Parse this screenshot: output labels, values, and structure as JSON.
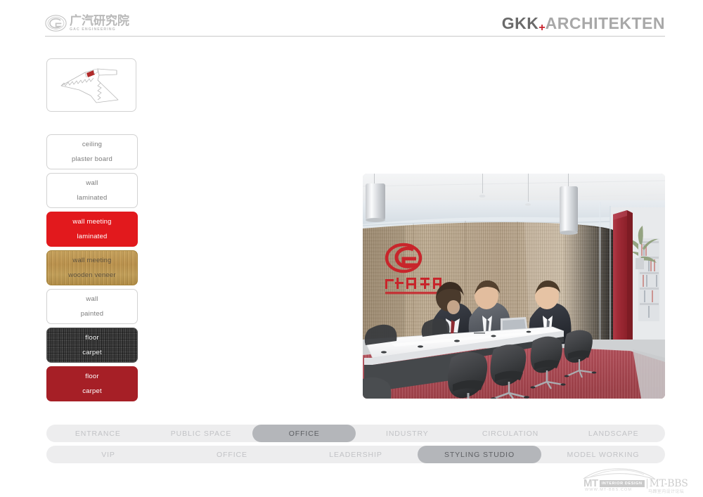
{
  "header": {
    "gac_logo": {
      "icon": "gac-g-emblem-icon",
      "chinese_name": "广汽研究院",
      "english_name": "GAC ENGINEERING"
    },
    "gkk_logo": {
      "part1": "GKK",
      "plus": "+",
      "part2": "ARCHITEKTEN",
      "accent_color": "#c8202a"
    }
  },
  "sidebar": {
    "plan_thumbnail": {
      "icon": "floor-plan-thumbnail-icon",
      "highlight_color": "#b02a2a"
    },
    "swatches": [
      {
        "element": "ceiling",
        "material": "plaster board",
        "style": "plain",
        "color": "#ffffff"
      },
      {
        "element": "wall",
        "material": "laminated",
        "style": "plain",
        "color": "#ffffff"
      },
      {
        "element": "wall meeting",
        "material": "laminated",
        "style": "red",
        "color": "#e2191d"
      },
      {
        "element": "wall meeting",
        "material": "wooden veneer",
        "style": "wood",
        "color": "#bb9149"
      },
      {
        "element": "wall",
        "material": "painted",
        "style": "plain",
        "color": "#ffffff"
      },
      {
        "element": "floor",
        "material": "carpet",
        "style": "carpet",
        "color": "#3a3a3a"
      },
      {
        "element": "floor",
        "material": "carpet",
        "style": "darkred",
        "color": "#a61f26"
      }
    ]
  },
  "main": {
    "render": {
      "name": "meeting-room-render",
      "description": "Office meeting room interior render with wood veneer wall, red GAC logo, white conference table, black chairs, red carpet and red column",
      "wall_logo_text": "广汽研究院",
      "wall_logo_color": "#c8252b",
      "carpet_color": "#b05058",
      "column_color": "#a8303c",
      "wood_wall_color": "#b49f82"
    }
  },
  "nav": {
    "primary": [
      {
        "label": "ENTRANCE",
        "active": false
      },
      {
        "label": "PUBLIC SPACE",
        "active": false
      },
      {
        "label": "OFFICE",
        "active": true
      },
      {
        "label": "INDUSTRY",
        "active": false
      },
      {
        "label": "CIRCULATION",
        "active": false
      },
      {
        "label": "LANDSCAPE",
        "active": false
      }
    ],
    "secondary": [
      {
        "label": "VIP",
        "active": false
      },
      {
        "label": "OFFICE",
        "active": false
      },
      {
        "label": "LEADERSHIP",
        "active": false
      },
      {
        "label": "STYLING STUDIO",
        "active": true
      },
      {
        "label": "MODEL WORKING",
        "active": false
      }
    ],
    "active_color": "#b4b6ba",
    "inactive_color": "#ededee"
  },
  "watermark": {
    "mt": "MT",
    "badge": "INTERIOR DESIGN",
    "bbs": "MT-BBS",
    "url": "WWW.MT-BBS.COM",
    "chinese": "马蹄室内设计论坛"
  }
}
